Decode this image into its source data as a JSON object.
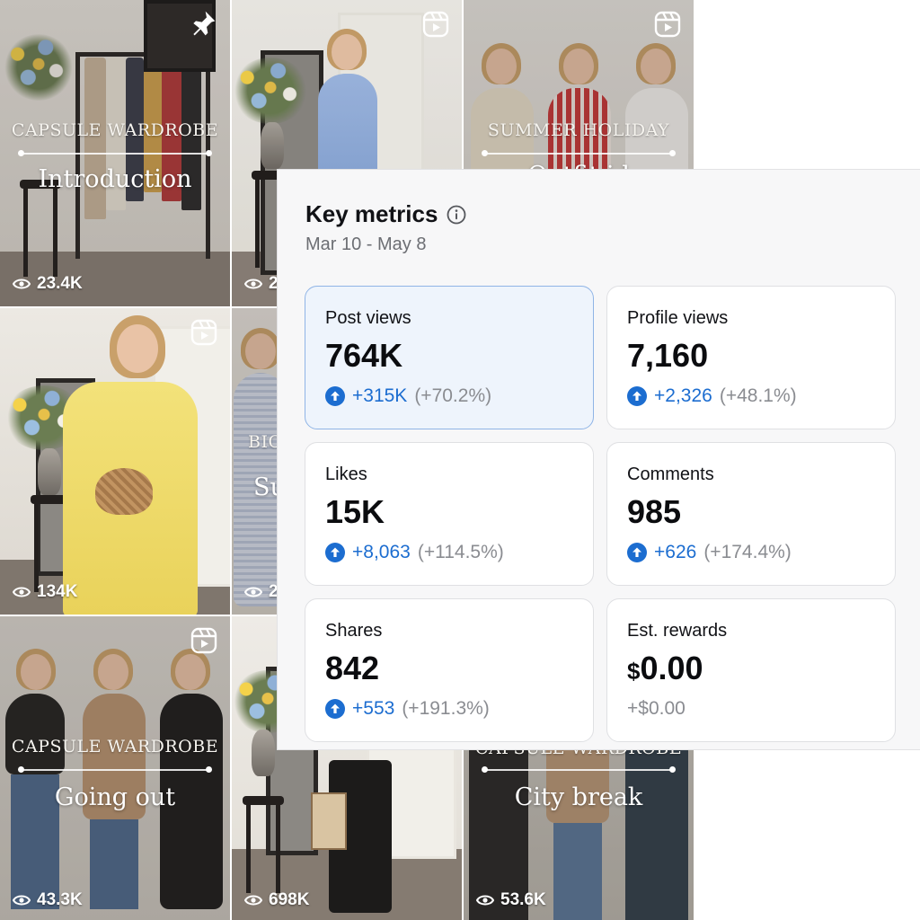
{
  "grid": {
    "tiles": [
      {
        "top_label": "CAPSULE WARDROBE",
        "main_label": "Introduction",
        "views": "23.4K",
        "badge": "pin-icon"
      },
      {
        "top_label": "",
        "main_label": "",
        "views": "2",
        "badge": "reel-icon"
      },
      {
        "top_label": "SUMMER HOLIDAY",
        "main_label": "Outfit id",
        "views": "",
        "badge": "reel-icon"
      },
      {
        "top_label": "",
        "main_label": "",
        "views": "134K",
        "badge": "reel-icon"
      },
      {
        "top_label": "BIC",
        "main_label": "Su",
        "views": "2",
        "badge": ""
      },
      {
        "top_label": "CAPSULE WARDROBE",
        "main_label": "Going out",
        "views": "43.3K",
        "badge": "reel-icon"
      },
      {
        "top_label": "",
        "main_label": "",
        "views": "698K",
        "badge": ""
      },
      {
        "top_label": "CAPSULE WARDROBE",
        "main_label": "City break",
        "views": "53.6K",
        "badge": ""
      }
    ]
  },
  "panel": {
    "title": "Key metrics",
    "range": "Mar 10 - May 8",
    "metrics": [
      {
        "label": "Post views",
        "value": "764K",
        "delta": "+315K",
        "pct": "(+70.2%)"
      },
      {
        "label": "Profile views",
        "value": "7,160",
        "delta": "+2,326",
        "pct": "(+48.1%)"
      },
      {
        "label": "Likes",
        "value": "15K",
        "delta": "+8,063",
        "pct": "(+114.5%)"
      },
      {
        "label": "Comments",
        "value": "985",
        "delta": "+626",
        "pct": "(+174.4%)"
      },
      {
        "label": "Shares",
        "value": "842",
        "delta": "+553",
        "pct": "(+191.3%)"
      },
      {
        "label": "Est. rewards",
        "currency": "$",
        "value": "0.00",
        "plain": "+$0.00"
      }
    ]
  },
  "colors": {
    "accent": "#1c6dd0",
    "active_card": "#eef4fc",
    "muted": "#8a8c91"
  }
}
